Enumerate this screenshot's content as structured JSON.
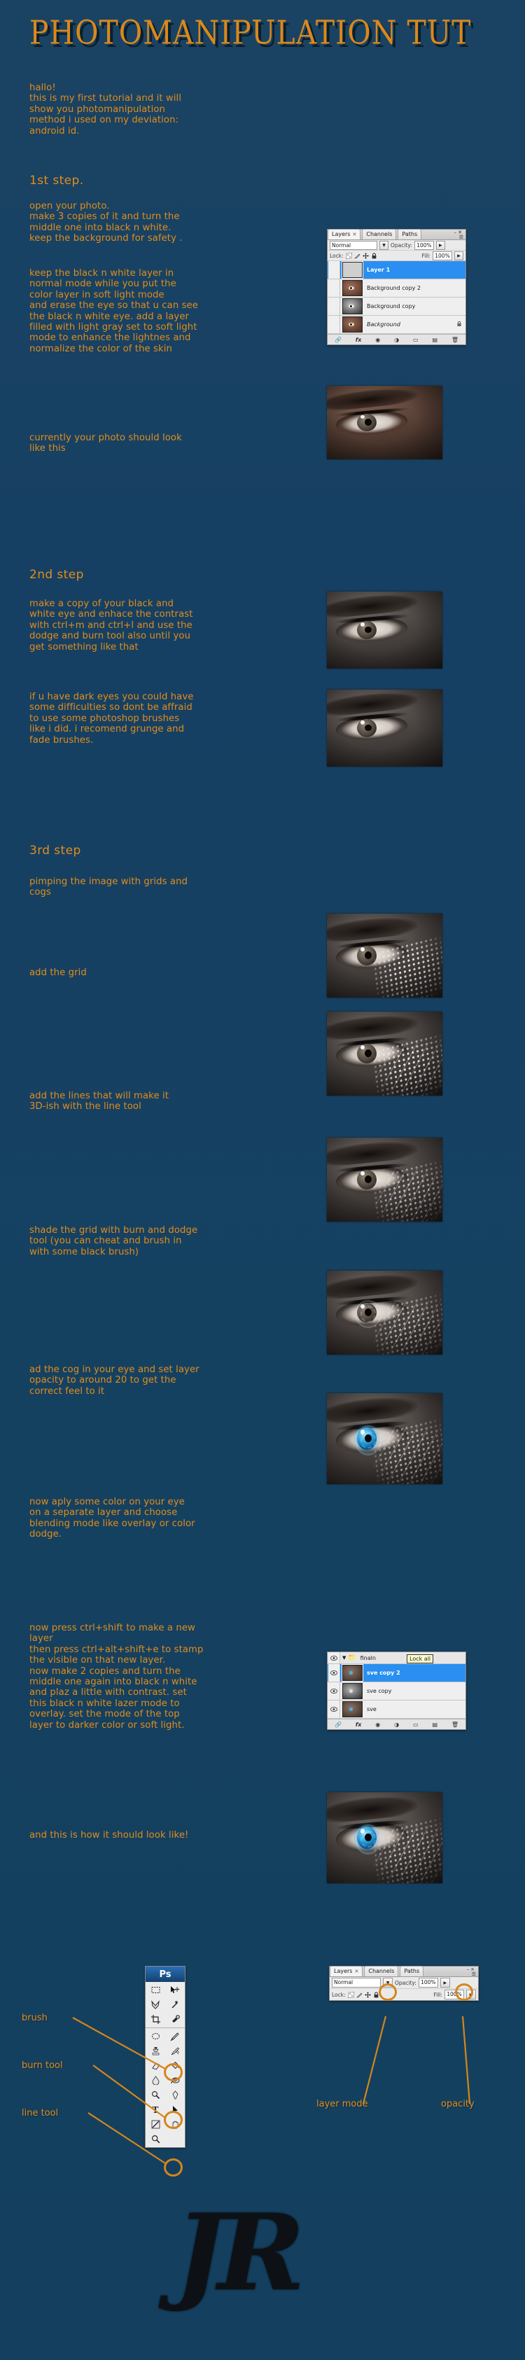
{
  "meta": {
    "bg_color": "#164063",
    "accent_color": "#e28d1b",
    "title_color": "#d9881d"
  },
  "title": "PHOTOMANIPULATION TUT",
  "intro": "hallo!\nthis is my first tutorial and it will\nshow you photomanipulation\nmethod i used on my deviation:\nandroid id.",
  "steps": {
    "step1_heading": "1st step.",
    "step1_text_a": "open your photo.\nmake 3 copies of it and turn the\nmiddle one into black n white.\nkeep the background for safety .",
    "step1_text_b": "keep the black n white layer  in\nnormal mode while you put the\ncolor layer in soft light mode\nand erase the eye so that u can see\nthe black n white eye. add a layer\nfilled with light gray set to soft light\nmode to enhance the lightnes and\nnormalize the color of the skin",
    "step1_text_c": "currently your photo should look\nlike this",
    "step2_heading": "2nd step",
    "step2_text_a": "make a copy of your black and\nwhite eye and enhace the contrast\nwith ctrl+m and ctrl+l and use the\ndodge and burn tool also until you\nget something like that",
    "step2_text_b": "if u have dark eyes you could have\nsome difficulties so dont be affraid\nto use some photoshop brushes\nlike i did. i recomend grunge and\nfade brushes.",
    "step3_heading": "3rd step",
    "step3_text_a": "pimping the image with grids and\ncogs",
    "step3_text_b": "add the grid",
    "step3_text_c": "add the lines that will make it\n3D-ish with the line tool",
    "step3_text_d": "shade the grid with burn and dodge\ntool (you can cheat and brush in\nwith some black brush)",
    "step3_text_e": "ad the cog in your eye and set layer\nopacity to around 20 to get the\ncorrect feel to it",
    "step3_text_f": "now aply some color on your eye\non a separate layer and choose\nblending mode like overlay or color\ndodge.",
    "step3_text_g": "now press ctrl+shift to make a new\nlayer\nthen press ctrl+alt+shift+e to stamp\nthe visible on that new layer.\nnow make 2 copies and turn the\nmiddle one again into black n white\nand plaz a little with contrast. set\nthis black n white lazer mode to\noverlay. set the mode of the top\nlayer to darker color or soft light.",
    "final_text": "and this is how it should look like!"
  },
  "panel_top": {
    "tabs": [
      "Layers",
      "Channels",
      "Paths"
    ],
    "active_tab": "Layers",
    "blend_mode": "Normal",
    "opacity_label": "Opacity:",
    "opacity_value": "100%",
    "lock_label": "Lock:",
    "fill_label": "Fill:",
    "fill_value": "100%",
    "layers": [
      {
        "name": "Layer 1",
        "selected": true,
        "locked": false,
        "italic": false
      },
      {
        "name": "Background copy 2",
        "selected": false,
        "locked": false,
        "italic": false
      },
      {
        "name": "Background copy",
        "selected": false,
        "locked": false,
        "italic": false
      },
      {
        "name": "Background",
        "selected": false,
        "locked": true,
        "italic": true
      }
    ],
    "footer_icons": [
      "link-icon",
      "fx-icon",
      "mask-icon",
      "adjustment-icon",
      "folder-icon",
      "new-layer-icon",
      "trash-icon"
    ]
  },
  "panel_bottom": {
    "group_name": "finaln",
    "tooltip": "Lock all",
    "layers": [
      {
        "name": "sve copy 2",
        "selected": true
      },
      {
        "name": "sve copy",
        "selected": false
      },
      {
        "name": "sve",
        "selected": false
      }
    ]
  },
  "panel_callout": {
    "tabs": [
      "Layers",
      "Channels",
      "Paths"
    ],
    "blend_mode": "Normal",
    "opacity_label": "Opacity:",
    "opacity_value": "100%",
    "lock_label": "Lock:",
    "fill_label": "Fill:",
    "fill_value": "100%",
    "callout_layer_mode": "layer mode",
    "callout_opacity": "opacity",
    "minimize_glyph": "–",
    "close_glyph": "×"
  },
  "toolbox": {
    "app_badge": "Ps",
    "callouts": [
      "brush",
      "burn tool",
      "line tool"
    ]
  },
  "signature": "JR"
}
